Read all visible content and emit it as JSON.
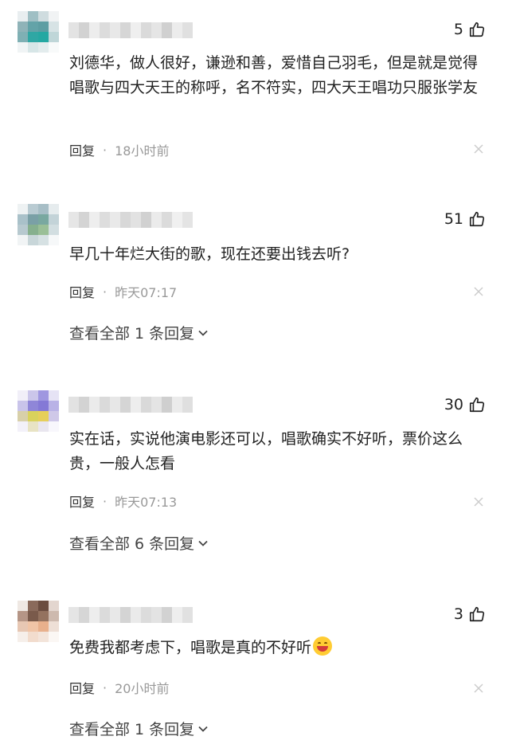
{
  "comments": [
    {
      "likes": "5",
      "text": "刘德华，做人很好，谦逊和善，爱惜自己羽毛，但是就是觉得唱歌与四大天王的称呼，名不符实，四大天王唱功只服张学友",
      "reply_label": "回复",
      "separator": "·",
      "time": "18小时前"
    },
    {
      "likes": "51",
      "text": "早几十年烂大街的歌，现在还要出钱去听?",
      "reply_label": "回复",
      "separator": "·",
      "time": "昨天07:17",
      "view_all": "查看全部 1 条回复"
    },
    {
      "likes": "30",
      "text": "实在话，实说他演电影还可以，唱歌确实不好听，票价这么贵，一般人怎看",
      "reply_label": "回复",
      "separator": "·",
      "time": "昨天07:13",
      "view_all": "查看全部 6 条回复"
    },
    {
      "likes": "3",
      "text": "免费我都考虑下，唱歌是真的不好听",
      "reply_label": "回复",
      "separator": "·",
      "time": "20小时前",
      "view_all": "查看全部 1 条回复"
    }
  ],
  "icons": {
    "like": "thumbs-up-icon",
    "close": "close-icon",
    "expand": "chevron-down-icon",
    "emoji": "grinning-face-emoji"
  },
  "colors": {
    "text": "#222222",
    "muted": "#999999",
    "close": "#cccccc"
  }
}
